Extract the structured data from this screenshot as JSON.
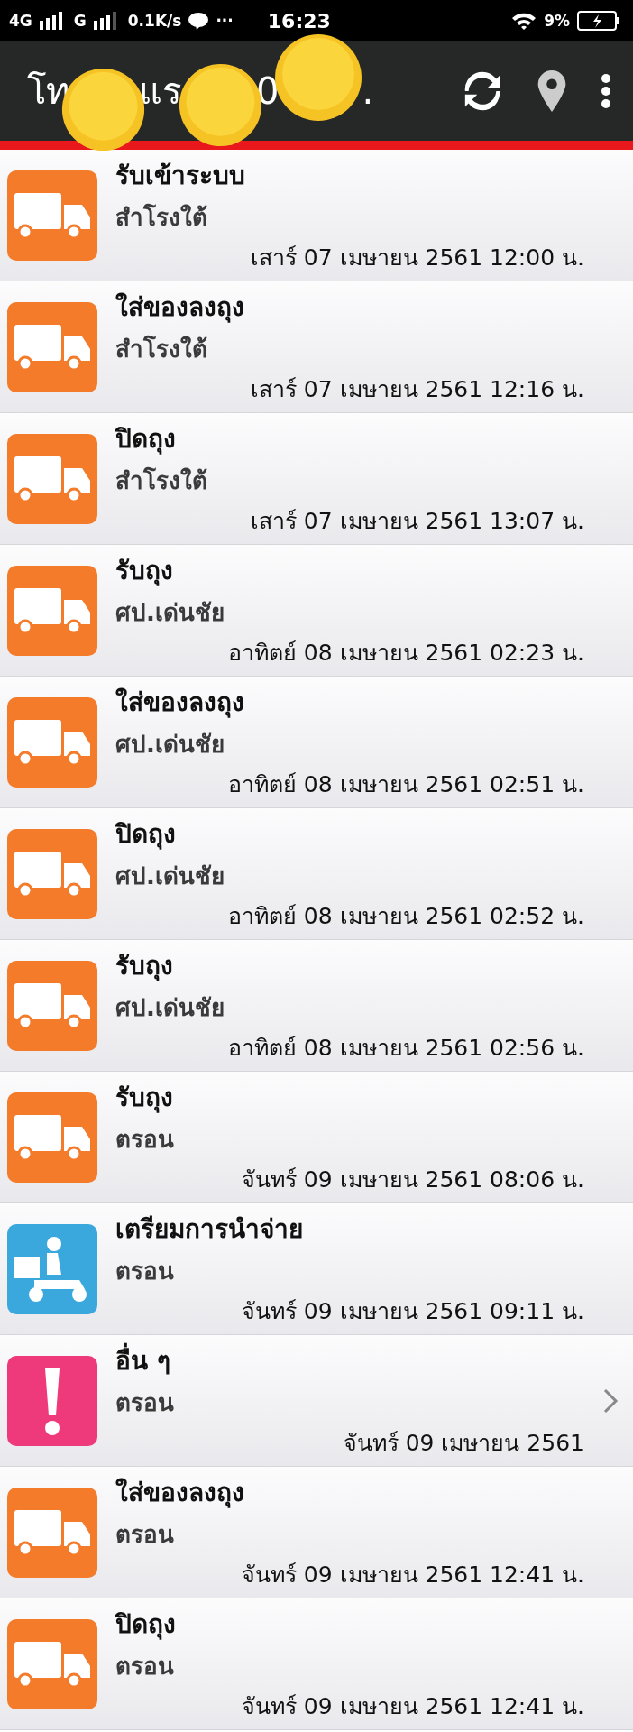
{
  "status_bar": {
    "network_1": "4G",
    "network_2": "G",
    "speed": "0.1K/s",
    "more": "···",
    "time": "16:23",
    "battery": "9%"
  },
  "header": {
    "title_parts": [
      "โท",
      "แร",
      "0",
      "."
    ]
  },
  "items": [
    {
      "kind": "truck",
      "title": "รับเข้าระบบ",
      "place": "สำโรงใต้",
      "date": "เสาร์ 07 เมษายน 2561 12:00 น.",
      "arrow": false
    },
    {
      "kind": "truck",
      "title": "ใส่ของลงถุง",
      "place": "สำโรงใต้",
      "date": "เสาร์ 07 เมษายน 2561 12:16 น.",
      "arrow": false
    },
    {
      "kind": "truck",
      "title": "ปิดถุง",
      "place": "สำโรงใต้",
      "date": "เสาร์ 07 เมษายน 2561 13:07 น.",
      "arrow": false
    },
    {
      "kind": "truck",
      "title": "รับถุง",
      "place": "ศป.เด่นชัย",
      "date": "อาทิตย์ 08 เมษายน 2561 02:23 น.",
      "arrow": false
    },
    {
      "kind": "truck",
      "title": "ใส่ของลงถุง",
      "place": "ศป.เด่นชัย",
      "date": "อาทิตย์ 08 เมษายน 2561 02:51 น.",
      "arrow": false
    },
    {
      "kind": "truck",
      "title": "ปิดถุง",
      "place": "ศป.เด่นชัย",
      "date": "อาทิตย์ 08 เมษายน 2561 02:52 น.",
      "arrow": false
    },
    {
      "kind": "truck",
      "title": "รับถุง",
      "place": "ศป.เด่นชัย",
      "date": "อาทิตย์ 08 เมษายน 2561 02:56 น.",
      "arrow": false
    },
    {
      "kind": "truck",
      "title": "รับถุง",
      "place": "ตรอน",
      "date": "จันทร์ 09 เมษายน 2561 08:06 น.",
      "arrow": false
    },
    {
      "kind": "scooter",
      "title": "เตรียมการนำจ่าย",
      "place": "ตรอน",
      "date": "จันทร์ 09 เมษายน 2561 09:11 น.",
      "arrow": false
    },
    {
      "kind": "alert",
      "title": "อื่น ๆ",
      "place": "ตรอน",
      "date": "จันทร์ 09 เมษายน 2561",
      "arrow": true
    },
    {
      "kind": "truck",
      "title": "ใส่ของลงถุง",
      "place": "ตรอน",
      "date": "จันทร์ 09 เมษายน 2561 12:41 น.",
      "arrow": false
    },
    {
      "kind": "truck",
      "title": "ปิดถุง",
      "place": "ตรอน",
      "date": "จันทร์ 09 เมษายน 2561 12:41 น.",
      "arrow": false
    }
  ]
}
